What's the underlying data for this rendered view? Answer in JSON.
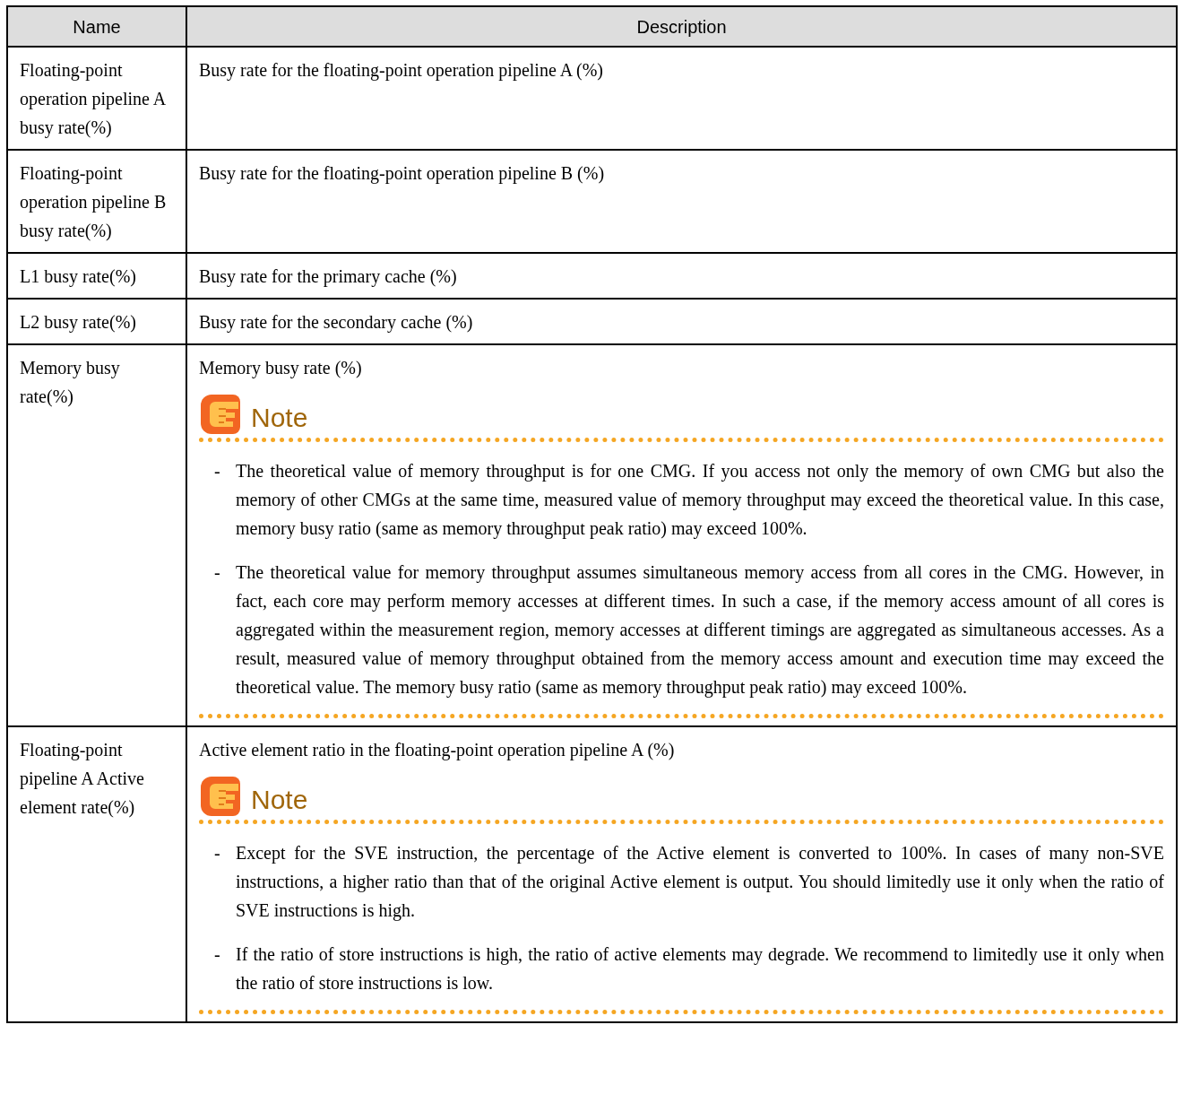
{
  "table": {
    "columns": [
      "Name",
      "Description"
    ],
    "rows": [
      {
        "name": "Floating-point operation pipeline A busy rate(%)",
        "description": "Busy rate for the floating-point operation pipeline A (%)"
      },
      {
        "name": "Floating-point operation pipeline B busy rate(%)",
        "description": "Busy rate for the floating-point operation pipeline B (%)"
      },
      {
        "name": "L1 busy rate(%)",
        "description": "Busy rate for the primary cache (%)"
      },
      {
        "name": "L2 busy rate(%)",
        "description": "Busy rate for the secondary cache (%)"
      },
      {
        "name": "Memory busy rate(%)",
        "description": "Memory busy rate (%)",
        "note": {
          "heading": "Note",
          "items": [
            {
              "bullet": "-",
              "text": "The theoretical value of memory throughput is for one CMG. If you access not only the memory of own CMG but also the memory of other CMGs at the same time, measured value of memory throughput may exceed the theoretical value. In this case, memory busy ratio (same as memory throughput peak ratio) may exceed 100%."
            },
            {
              "bullet": "-",
              "text": "The theoretical value for memory throughput assumes simultaneous memory access from all cores in the CMG. However, in fact, each core may perform memory accesses at different times. In such a case, if the memory access amount of all cores is aggregated within the measurement region, memory accesses at different timings are aggregated as simultaneous accesses. As a result, measured value of memory throughput obtained from the memory access amount and execution time may exceed the theoretical value. The memory busy ratio (same as memory throughput peak ratio) may exceed 100%."
            }
          ]
        }
      },
      {
        "name": "Floating-point pipeline A Active element rate(%)",
        "description": "Active element ratio in the floating-point operation pipeline A (%)",
        "note": {
          "heading": "Note",
          "items": [
            {
              "bullet": "-",
              "text": "Except for the SVE instruction, the percentage of the Active element is converted to 100%. In cases of many non-SVE instructions, a higher ratio than that of the original Active element is output. You should limitedly use it only when the ratio of SVE instructions is high."
            },
            {
              "bullet": "-",
              "text": "If the ratio of store instructions is high, the ratio of active elements may degrade. We recommend to limitedly use it only when the ratio of store instructions is low."
            }
          ]
        }
      }
    ]
  }
}
